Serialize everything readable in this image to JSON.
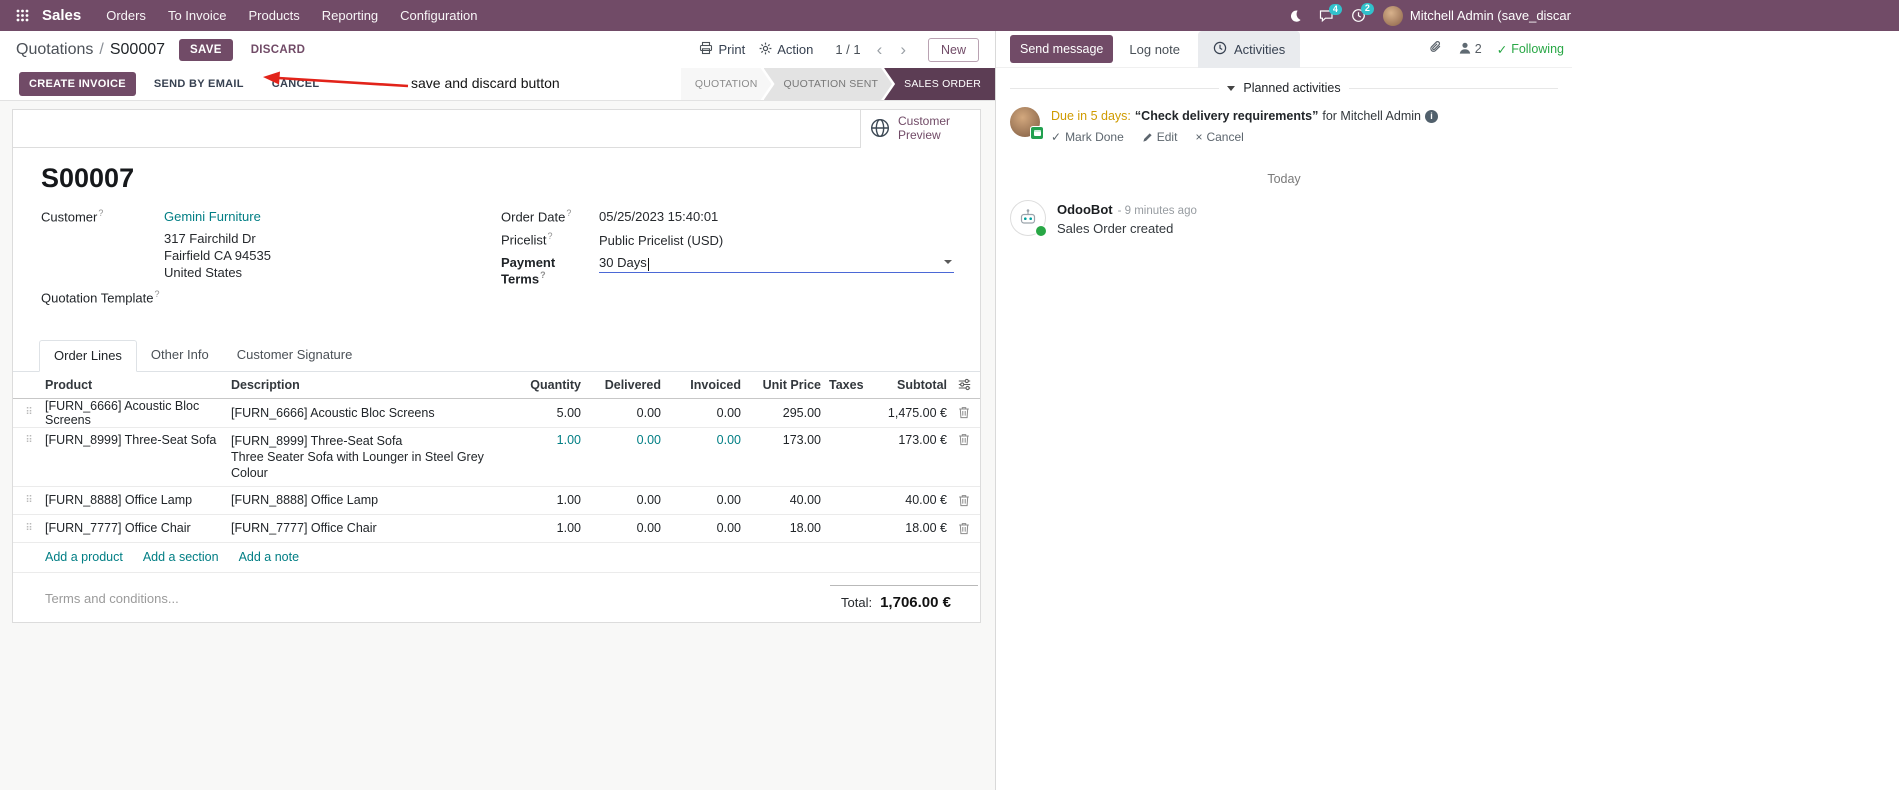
{
  "help_marker": "?",
  "nav": {
    "app_name": "Sales",
    "menus": [
      "Orders",
      "To Invoice",
      "Products",
      "Reporting",
      "Configuration"
    ],
    "messages_badge": "4",
    "activities_badge": "2",
    "user_name": "Mitchell Admin (save_discar"
  },
  "control_panel": {
    "breadcrumb_parent": "Quotations",
    "breadcrumb_separator": "/",
    "breadcrumb_current": "S00007",
    "save": "SAVE",
    "discard": "DISCARD",
    "print": "Print",
    "action": "Action",
    "pager": "1 / 1",
    "new": "New"
  },
  "annotation": {
    "text": "save and discard button"
  },
  "statusbar": {
    "create_invoice": "CREATE INVOICE",
    "send_by_email": "SEND BY EMAIL",
    "cancel": "CANCEL",
    "stages": [
      {
        "label": "QUOTATION",
        "active": false
      },
      {
        "label": "QUOTATION SENT",
        "active": false
      },
      {
        "label": "SALES ORDER",
        "active": true
      }
    ]
  },
  "sheet": {
    "customer_preview": "Customer Preview",
    "title": "S00007",
    "customer_label": "Customer",
    "customer_value": "Gemini Furniture",
    "address": [
      "317 Fairchild Dr",
      "Fairfield CA 94535",
      "United States"
    ],
    "quotation_template_label": "Quotation Template",
    "order_date_label": "Order Date",
    "order_date_value": "05/25/2023 15:40:01",
    "pricelist_label": "Pricelist",
    "pricelist_value": "Public Pricelist (USD)",
    "payment_terms_label": "Payment Terms",
    "payment_terms_value": "30 Days",
    "tabs": [
      "Order Lines",
      "Other Info",
      "Customer Signature"
    ],
    "columns": {
      "product": "Product",
      "description": "Description",
      "quantity": "Quantity",
      "delivered": "Delivered",
      "invoiced": "Invoiced",
      "unit_price": "Unit Price",
      "taxes": "Taxes",
      "subtotal": "Subtotal"
    },
    "rows": [
      {
        "product": "[FURN_6666] Acoustic Bloc Screens",
        "description": "[FURN_6666] Acoustic Bloc Screens",
        "description2": "",
        "quantity": "5.00",
        "delivered": "0.00",
        "invoiced": "0.00",
        "unit_price": "295.00",
        "taxes": "",
        "subtotal": "1,475.00 €"
      },
      {
        "product": "[FURN_8999] Three-Seat Sofa",
        "description": "[FURN_8999] Three-Seat Sofa",
        "description2": "Three Seater Sofa with Lounger in Steel Grey Colour",
        "quantity": "1.00",
        "delivered": "0.00",
        "invoiced": "0.00",
        "unit_price": "173.00",
        "taxes": "",
        "subtotal": "173.00 €"
      },
      {
        "product": "[FURN_8888] Office Lamp",
        "description": "[FURN_8888] Office Lamp",
        "description2": "",
        "quantity": "1.00",
        "delivered": "0.00",
        "invoiced": "0.00",
        "unit_price": "40.00",
        "taxes": "",
        "subtotal": "40.00 €"
      },
      {
        "product": "[FURN_7777] Office Chair",
        "description": "[FURN_7777] Office Chair",
        "description2": "",
        "quantity": "1.00",
        "delivered": "0.00",
        "invoiced": "0.00",
        "unit_price": "18.00",
        "taxes": "",
        "subtotal": "18.00 €"
      }
    ],
    "add_product": "Add a product",
    "add_section": "Add a section",
    "add_note": "Add a note",
    "terms_placeholder": "Terms and conditions...",
    "total_label": "Total:",
    "total_value": "1,706.00 €"
  },
  "chatter": {
    "send_message": "Send message",
    "log_note": "Log note",
    "activities": "Activities",
    "followers_count": "2",
    "following": "Following",
    "planned_activities": "Planned activities",
    "activity": {
      "due": "Due in 5 days:",
      "summary": "“Check delivery requirements”",
      "assignee": "for Mitchell Admin",
      "mark_done": "Mark Done",
      "edit": "Edit",
      "cancel": "Cancel"
    },
    "date_divider": "Today",
    "message": {
      "author": "OdooBot",
      "time": "- 9 minutes ago",
      "body": "Sales Order created"
    }
  },
  "colors": {
    "primary": "#714B67",
    "stage_active": "#5c3d54",
    "link": "#017e84",
    "badge": "#31c1cc",
    "following_green": "#28a745",
    "annotation_red": "#e2231a",
    "due_orange": "#cf9b00",
    "focus_blue": "#4b68d6"
  }
}
